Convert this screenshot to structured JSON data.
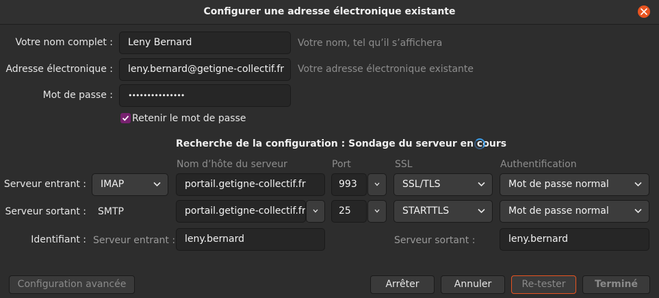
{
  "window": {
    "title": "Configurer une adresse électronique existante"
  },
  "account": {
    "name_label": "Votre nom complet :",
    "name_value": "Leny Bernard",
    "name_hint": "Votre nom, tel qu’il s’affichera",
    "email_label": "Adresse électronique :",
    "email_value": "leny.bernard@getigne-collectif.fr",
    "email_hint": "Votre adresse électronique existante",
    "password_label": "Mot de passe :",
    "password_value": "•••••••••••••••",
    "remember_label": "Retenir le mot de passe",
    "remember_checked": true
  },
  "status": {
    "text": "Recherche de la configuration : Sondage du serveur en cours"
  },
  "columns": {
    "host": "Nom d’hôte du serveur",
    "port": "Port",
    "ssl": "SSL",
    "auth": "Authentification"
  },
  "incoming": {
    "label": "Serveur entrant :",
    "protocol": "IMAP",
    "host": "portail.getigne-collectif.fr",
    "port": "993",
    "ssl": "SSL/TLS",
    "auth": "Mot de passe normal"
  },
  "outgoing": {
    "label": "Serveur sortant :",
    "protocol": "SMTP",
    "host": "portail.getigne-collectif.fr",
    "port": "25",
    "ssl": "STARTTLS",
    "auth": "Mot de passe normal"
  },
  "identity": {
    "label": "Identifiant :",
    "incoming_label": "Serveur entrant :",
    "incoming_value": "leny.bernard",
    "outgoing_label": "Serveur sortant :",
    "outgoing_value": "leny.bernard"
  },
  "buttons": {
    "advanced": "Configuration avancée",
    "stop": "Arrêter",
    "cancel": "Annuler",
    "retest": "Re-tester",
    "done": "Terminé"
  },
  "colors": {
    "accent": "#e95420",
    "checkbox": "#77216f",
    "spinner": "#3a9ce8"
  },
  "icons": {
    "close": "close-icon",
    "dropdown": "chevron-down-icon",
    "check": "check-icon",
    "spinner": "spinner-icon"
  }
}
